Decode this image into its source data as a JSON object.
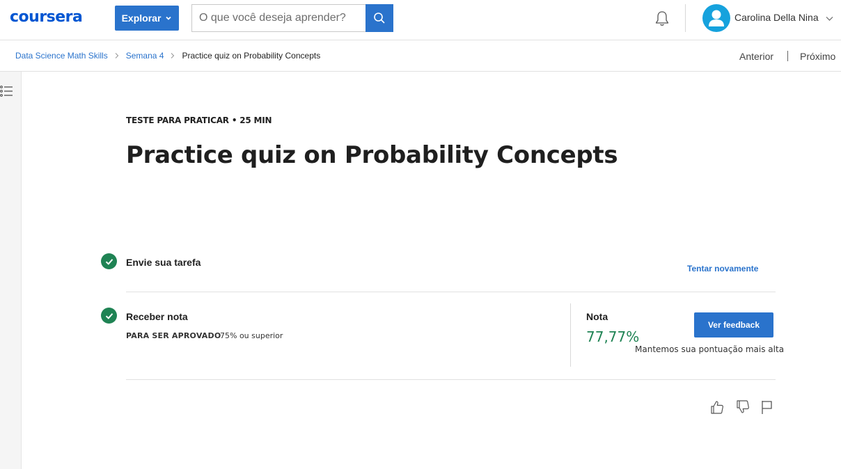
{
  "header": {
    "logo_text": "coursera",
    "explore_label": "Explorar",
    "search_placeholder": "O que você deseja aprender?",
    "user_name": "Carolina Della Nina"
  },
  "breadcrumb": {
    "items": [
      "Data Science Math Skills",
      "Semana 4",
      "Practice quiz on Probability Concepts"
    ],
    "prev_label": "Anterior",
    "next_label": "Próximo"
  },
  "main": {
    "kicker": "TESTE PARA PRATICAR • 25 MIN",
    "title": "Practice quiz on Probability Concepts",
    "steps": [
      {
        "label": "Envie sua tarefa",
        "action_label": "Tentar novamente"
      },
      {
        "label": "Receber nota"
      }
    ],
    "pass_requirement_label": "PARA SER APROVADO",
    "pass_requirement_value": "75% ou superior",
    "grade_label": "Nota",
    "grade_value": "77,77%",
    "feedback_label": "Ver feedback",
    "keep_note": "Mantemos sua pontuação mais alta"
  },
  "colors": {
    "brand": "#0056d2",
    "primary_button": "#2a73cc",
    "success": "#1f8354"
  },
  "icons": [
    "search-icon",
    "bell-icon",
    "user-avatar-icon",
    "chevron-down-icon",
    "list-menu-icon",
    "check-icon",
    "thumbs-up-icon",
    "thumbs-down-icon",
    "flag-icon"
  ]
}
